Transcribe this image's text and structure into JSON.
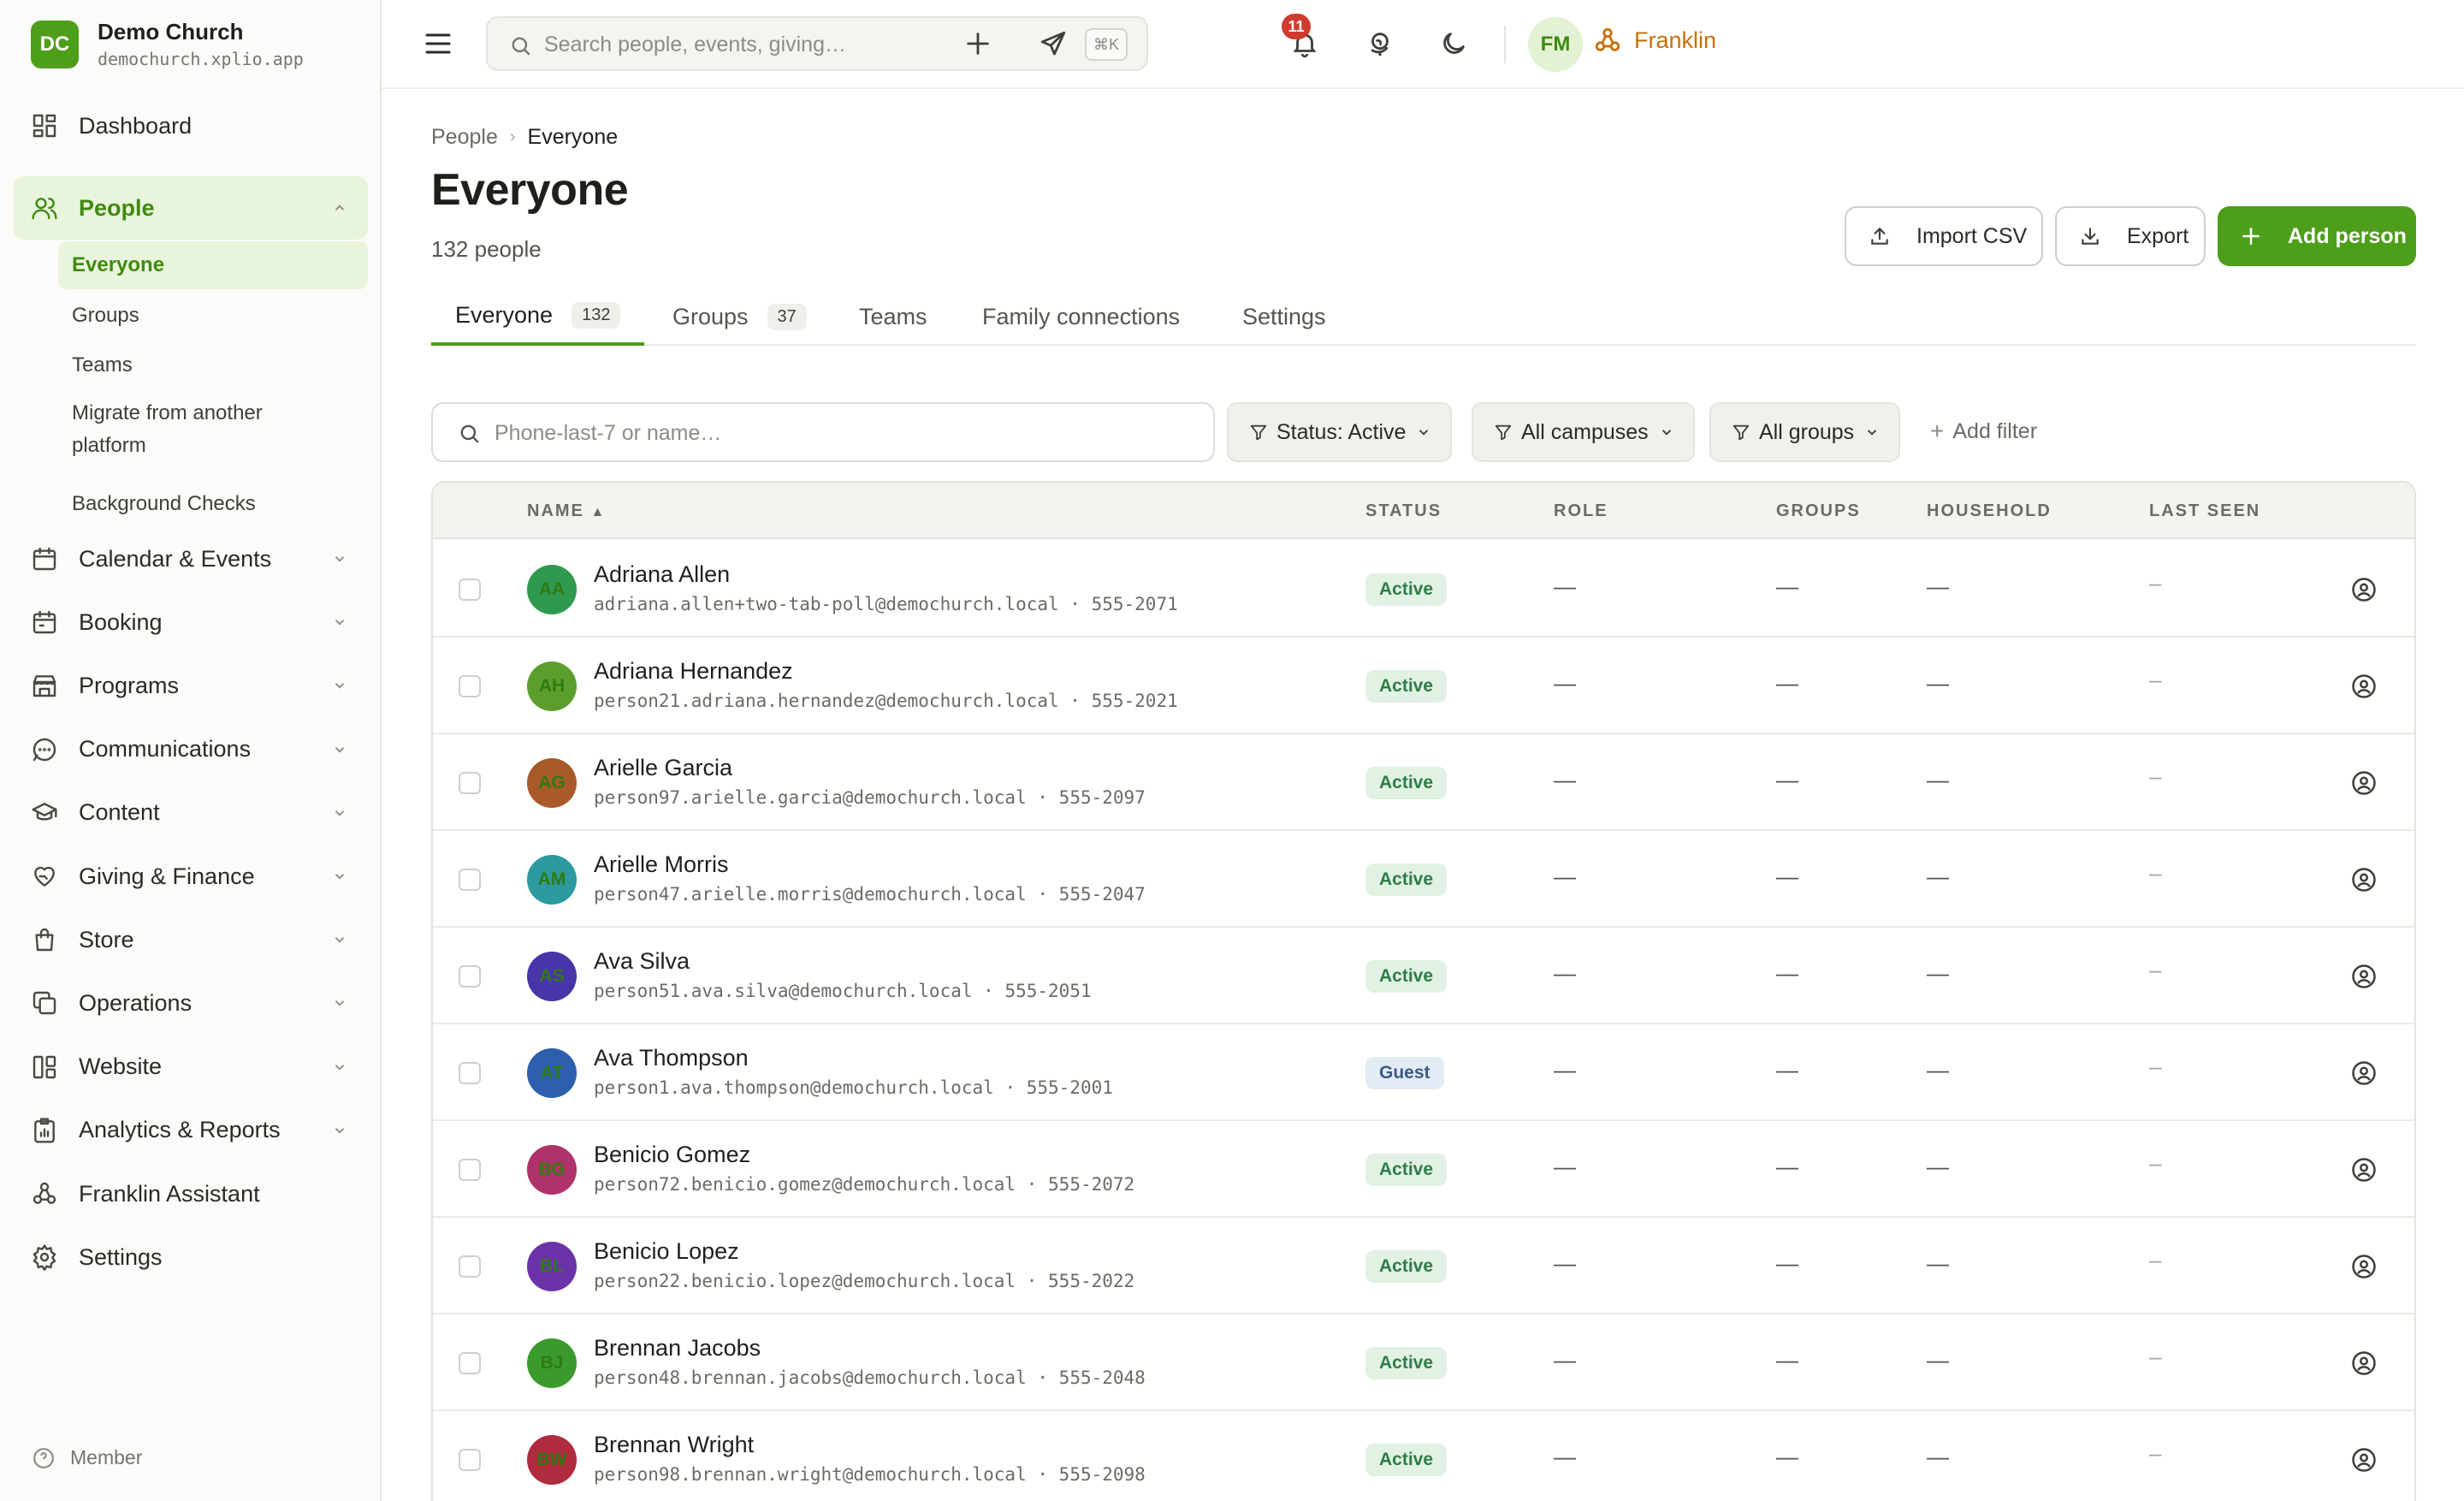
{
  "brand": {
    "initials": "DC",
    "name": "Demo Church",
    "domain": "demochurch.xplio.app"
  },
  "sidebar": {
    "items": [
      {
        "label": "Dashboard",
        "icon": "dashboard-icon",
        "chevron": false
      },
      {
        "label": "People",
        "icon": "people-icon",
        "chevron": true,
        "expanded": true
      },
      {
        "label": "Calendar & Events",
        "icon": "calendar-icon",
        "chevron": true
      },
      {
        "label": "Booking",
        "icon": "booking-icon",
        "chevron": true
      },
      {
        "label": "Programs",
        "icon": "programs-icon",
        "chevron": true
      },
      {
        "label": "Communications",
        "icon": "chat-icon",
        "chevron": true
      },
      {
        "label": "Content",
        "icon": "graduation-cap-icon",
        "chevron": true
      },
      {
        "label": "Giving & Finance",
        "icon": "heart-hand-icon",
        "chevron": true
      },
      {
        "label": "Store",
        "icon": "shopping-bag-icon",
        "chevron": true
      },
      {
        "label": "Operations",
        "icon": "copy-icon",
        "chevron": true
      },
      {
        "label": "Website",
        "icon": "layout-icon",
        "chevron": true
      },
      {
        "label": "Analytics & Reports",
        "icon": "report-icon",
        "chevron": true
      },
      {
        "label": "Franklin Assistant",
        "icon": "assistant-icon",
        "chevron": false
      },
      {
        "label": "Settings",
        "icon": "gear-icon",
        "chevron": false
      }
    ],
    "people_sub": [
      "Everyone",
      "Groups",
      "Teams",
      "Migrate from another platform",
      "Background Checks"
    ],
    "footer": "Member"
  },
  "topbar": {
    "search_placeholder": "Search people, events, giving…",
    "shortcut": "⌘K",
    "assistant_label": "Franklin",
    "notification_count": "11",
    "avatar_initials": "FM"
  },
  "page": {
    "breadcrumb": [
      "People",
      "Everyone"
    ],
    "title": "Everyone",
    "count_text": "132 people",
    "import_label": "Import CSV",
    "export_label": "Export",
    "add_label": "Add person"
  },
  "tabs": [
    {
      "label": "Everyone",
      "count": "132"
    },
    {
      "label": "Groups",
      "count": "37"
    },
    {
      "label": "Teams",
      "count": ""
    },
    {
      "label": "Family connections",
      "count": ""
    },
    {
      "label": "Settings",
      "count": ""
    }
  ],
  "filters": {
    "search_placeholder": "Phone-last-7 or name…",
    "status": "Status: Active",
    "campuses": "All campuses",
    "groups": "All groups",
    "add_filter": "Add filter"
  },
  "table": {
    "columns": [
      "NAME",
      "STATUS",
      "ROLE",
      "GROUPS",
      "HOUSEHOLD",
      "LAST SEEN"
    ],
    "empty": "—",
    "empty_last_seen": "–",
    "rows": [
      {
        "initials": "AA",
        "name": "Adriana Allen",
        "email": "adriana.allen+two-tab-poll@demochurch.local",
        "phone": "555-2071",
        "status": "Active",
        "color": "#2f9a4f"
      },
      {
        "initials": "AH",
        "name": "Adriana Hernandez",
        "email": "person21.adriana.hernandez@demochurch.local",
        "phone": "555-2021",
        "status": "Active",
        "color": "#5c9e2b"
      },
      {
        "initials": "AG",
        "name": "Arielle Garcia",
        "email": "person97.arielle.garcia@demochurch.local",
        "phone": "555-2097",
        "status": "Active",
        "color": "#a85a2a"
      },
      {
        "initials": "AM",
        "name": "Arielle Morris",
        "email": "person47.arielle.morris@demochurch.local",
        "phone": "555-2047",
        "status": "Active",
        "color": "#2c9aa0"
      },
      {
        "initials": "AS",
        "name": "Ava Silva",
        "email": "person51.ava.silva@demochurch.local",
        "phone": "555-2051",
        "status": "Active",
        "color": "#4a35a8"
      },
      {
        "initials": "AT",
        "name": "Ava Thompson",
        "email": "person1.ava.thompson@demochurch.local",
        "phone": "555-2001",
        "status": "Guest",
        "color": "#2d5fae"
      },
      {
        "initials": "BG",
        "name": "Benicio Gomez",
        "email": "person72.benicio.gomez@demochurch.local",
        "phone": "555-2072",
        "status": "Active",
        "color": "#b0326a"
      },
      {
        "initials": "BL",
        "name": "Benicio Lopez",
        "email": "person22.benicio.lopez@demochurch.local",
        "phone": "555-2022",
        "status": "Active",
        "color": "#6a34a8"
      },
      {
        "initials": "BJ",
        "name": "Brennan Jacobs",
        "email": "person48.brennan.jacobs@demochurch.local",
        "phone": "555-2048",
        "status": "Active",
        "color": "#3b9a2c"
      },
      {
        "initials": "BW",
        "name": "Brennan Wright",
        "email": "person98.brennan.wright@demochurch.local",
        "phone": "555-2098",
        "status": "Active",
        "color": "#b02b3e"
      }
    ]
  }
}
